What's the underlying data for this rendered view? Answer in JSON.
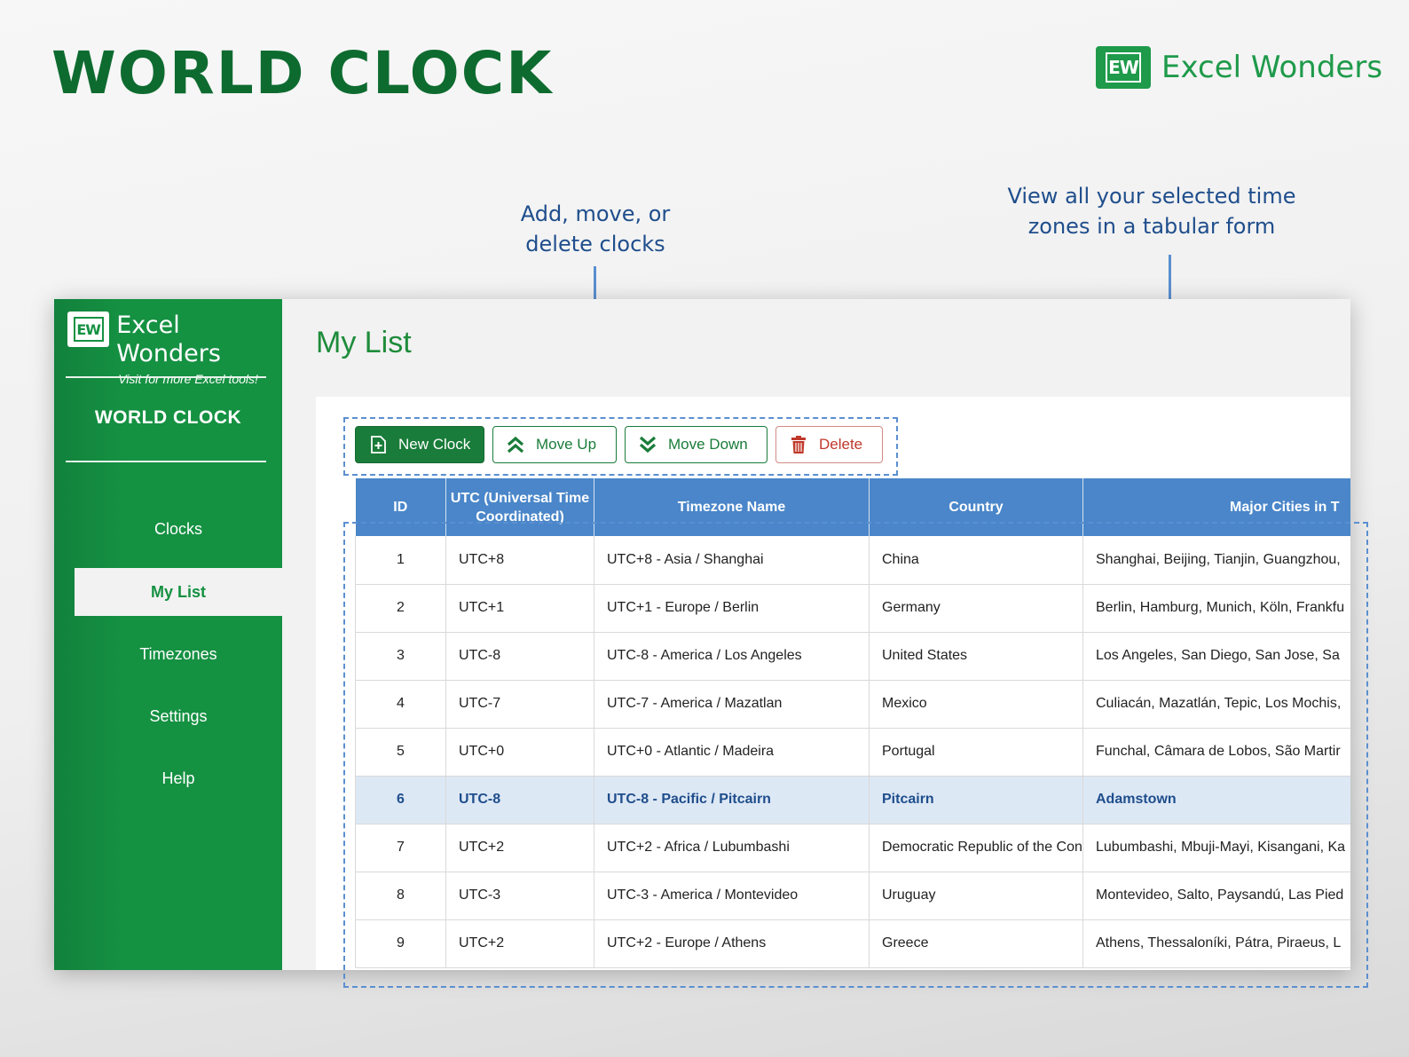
{
  "header": {
    "title": "WORLD CLOCK",
    "brand_mark": "EW",
    "brand_name": "Excel Wonders"
  },
  "callouts": {
    "toolbar_line1": "Add, move, or",
    "toolbar_line2": "delete clocks",
    "table_line1": "View all your selected time",
    "table_line2": "zones in a tabular form"
  },
  "sidebar": {
    "brand_mark": "EW",
    "brand_name": "Excel Wonders",
    "brand_tagline": "Visit for more Excel tools!",
    "app_title": "WORLD CLOCK",
    "items": [
      {
        "label": "Clocks"
      },
      {
        "label": "My List"
      },
      {
        "label": "Timezones"
      },
      {
        "label": "Settings"
      },
      {
        "label": "Help"
      }
    ],
    "active_item": "My List"
  },
  "main": {
    "title": "My List"
  },
  "toolbar": {
    "new_clock": "New Clock",
    "move_up": "Move Up",
    "move_down": "Move Down",
    "delete": "Delete"
  },
  "table": {
    "columns": [
      "ID",
      "UTC (Universal Time Coordinated)",
      "Timezone Name",
      "Country",
      "Major Cities in T"
    ],
    "rows": [
      [
        "1",
        "UTC+8",
        "UTC+8 - Asia / Shanghai",
        "China",
        "Shanghai, Beijing, Tianjin, Guangzhou,"
      ],
      [
        "2",
        "UTC+1",
        "UTC+1 - Europe / Berlin",
        "Germany",
        "Berlin, Hamburg, Munich, Köln, Frankfu"
      ],
      [
        "3",
        "UTC-8",
        "UTC-8 - America / Los Angeles",
        "United States",
        "Los Angeles, San Diego, San Jose, Sa"
      ],
      [
        "4",
        "UTC-7",
        "UTC-7 - America / Mazatlan",
        "Mexico",
        "Culiacán, Mazatlán, Tepic, Los Mochis,"
      ],
      [
        "5",
        "UTC+0",
        "UTC+0 - Atlantic / Madeira",
        "Portugal",
        "Funchal, Câmara de Lobos, São Martir"
      ],
      [
        "6",
        "UTC-8",
        "UTC-8 - Pacific / Pitcairn",
        "Pitcairn",
        "Adamstown"
      ],
      [
        "7",
        "UTC+2",
        "UTC+2 - Africa / Lubumbashi",
        "Democratic Republic of the Con",
        "Lubumbashi, Mbuji-Mayi, Kisangani, Ka"
      ],
      [
        "8",
        "UTC-3",
        "UTC-3 - America / Montevideo",
        "Uruguay",
        "Montevideo, Salto, Paysandú, Las Pied"
      ],
      [
        "9",
        "UTC+2",
        "UTC+2 - Europe / Athens",
        "Greece",
        "Athens, Thessaloníki, Pátra, Piraeus, L"
      ]
    ],
    "selected_row": 6
  },
  "colors": {
    "brand_green": "#159142",
    "title_green": "#0e6b30",
    "header_blue": "#4a86c9",
    "callout_blue": "#1f4e8c",
    "selected_row": "#dde8f5",
    "delete_red": "#c0392b"
  },
  "icons": {
    "new_clock": "new-document-icon",
    "move_up": "double-chevron-up-icon",
    "move_down": "double-chevron-down-icon",
    "delete": "trash-icon"
  }
}
